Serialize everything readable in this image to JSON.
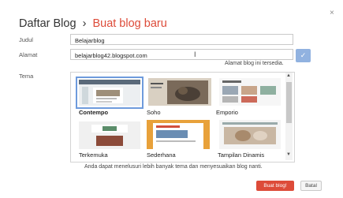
{
  "dialog": {
    "breadcrumb_root": "Daftar Blog",
    "separator": "›",
    "breadcrumb_current": "Buat blog baru",
    "close_glyph": "×"
  },
  "form": {
    "title_label": "Judul",
    "title_value": "Belajarblog",
    "address_label": "Alamat",
    "address_value": "belajarblog42.blogspot.com",
    "availability_text": "Alamat blog ini tersedia.",
    "theme_label": "Tema"
  },
  "themes": [
    {
      "name": "Contempo",
      "selected": true
    },
    {
      "name": "Soho",
      "selected": false
    },
    {
      "name": "Emporio",
      "selected": false
    },
    {
      "name": "Terkemuka",
      "selected": false
    },
    {
      "name": "Sederhana",
      "selected": false
    },
    {
      "name": "Tampilan Dinamis",
      "selected": false
    }
  ],
  "note": "Anda dapat menelusuri lebih banyak tema dan menyesuaikan blog nanti.",
  "buttons": {
    "create": "Buat blog!",
    "cancel": "Batal"
  },
  "colors": {
    "accent": "#dd4b39",
    "selection": "#6e9bdc",
    "check_button": "#91b2e0"
  },
  "icons": {
    "close": "close-icon",
    "check": "check-icon",
    "text_cursor": "text-cursor-icon"
  }
}
